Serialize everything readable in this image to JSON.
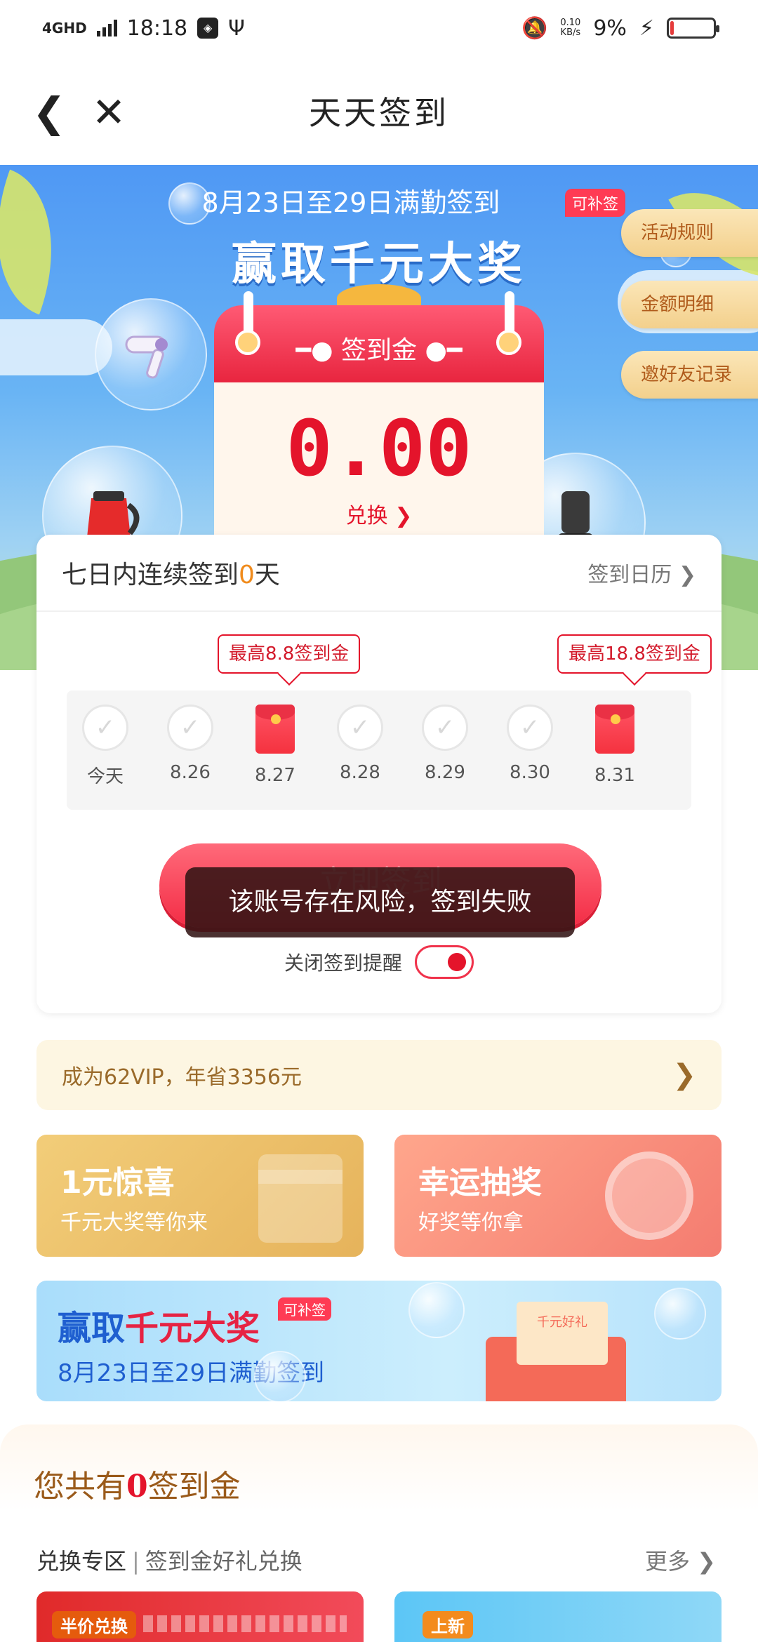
{
  "status_bar": {
    "network": "4GHD",
    "time": "18:18",
    "speed_value": "0.10",
    "speed_unit": "KB/s",
    "battery_percent": "9%",
    "battery_level": 0.09
  },
  "nav": {
    "back_glyph": "❮",
    "close_glyph": "✕",
    "title": "天天签到"
  },
  "banner": {
    "subtitle": "8月23日至29日满勤签到",
    "makeup_tag": "可补签",
    "title": "赢取千元大奖",
    "calendar_label": "━●  签到金  ●━",
    "amount": "0.00",
    "exchange_label": "兑换 ❯",
    "side_buttons": [
      "活动规则",
      "金额明细",
      "邀好友记录"
    ]
  },
  "sign_card": {
    "title_prefix": "七日内连续签到",
    "streak": "0",
    "title_suffix": "天",
    "calendar_link": "签到日历 ❯",
    "tips": [
      "最高8.8签到金",
      "最高18.8签到金"
    ],
    "days": [
      {
        "label": "今天",
        "kind": "check"
      },
      {
        "label": "8.26",
        "kind": "check"
      },
      {
        "label": "8.27",
        "kind": "packet"
      },
      {
        "label": "8.28",
        "kind": "check"
      },
      {
        "label": "8.29",
        "kind": "check"
      },
      {
        "label": "8.30",
        "kind": "check"
      },
      {
        "label": "8.31",
        "kind": "packet"
      }
    ],
    "sign_button_label": "立即签到",
    "toast": "该账号存在风险，签到失败",
    "reminder_label": "关闭签到提醒",
    "reminder_on": true
  },
  "vip": {
    "text": "成为62VIP，年省3356元",
    "arrow": "❯"
  },
  "tiles": [
    {
      "title": "1元惊喜",
      "subtitle": "千元大奖等你来"
    },
    {
      "title": "幸运抽奖",
      "subtitle": "好奖等你拿"
    }
  ],
  "promo": {
    "title_blue": "赢取",
    "title_red": "千元大奖",
    "tag": "可补签",
    "subtitle": "8月23日至29日满勤签到",
    "box_text": "千元好礼"
  },
  "coins": {
    "prefix": "您共有",
    "count": "0",
    "suffix": "签到金",
    "exchange_title": "兑换专区",
    "exchange_sep": "|",
    "exchange_sub": "签到金好礼兑换",
    "more": "更多 ❯",
    "cards": [
      {
        "badge": "半价兑换"
      },
      {
        "badge": "上新"
      }
    ]
  },
  "colors": {
    "accent_red": "#e4142b",
    "streak_orange": "#f08b1c",
    "vip_brown": "#9a6a2a"
  }
}
